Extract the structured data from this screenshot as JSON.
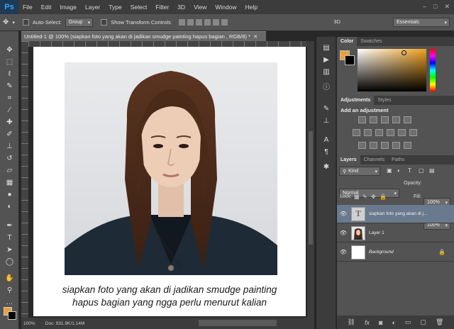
{
  "app": {
    "logo": "Ps"
  },
  "menu": [
    "File",
    "Edit",
    "Image",
    "Layer",
    "Type",
    "Select",
    "Filter",
    "3D",
    "View",
    "Window",
    "Help"
  ],
  "window_controls": [
    "–",
    "□",
    "✕"
  ],
  "options": {
    "auto_select_label": "Auto-Select:",
    "auto_select_value": "Group",
    "show_transform_label": "Show Transform Controls",
    "mode_3d_label": "3D",
    "workspace": "Essentials"
  },
  "document": {
    "tab_title": "Untitled-1 @ 100% (siapkan foto yang akan di jadikan smudge painting hapus bagian , RGB/8) *",
    "caption_line1": "siapkan foto yang akan di jadikan smudge painting",
    "caption_line2": "hapus bagian yang ngga perlu menurut kalian",
    "zoom": "100%",
    "doc_size": "Doc: 931.9K/1.14M"
  },
  "color_panel": {
    "tabs": [
      "Color",
      "Swatches"
    ],
    "foreground": "#e8a13a",
    "background": "#000000"
  },
  "adjustments_panel": {
    "tabs": [
      "Adjustments",
      "Styles"
    ],
    "title": "Add an adjustment"
  },
  "layers_panel": {
    "tabs": [
      "Layers",
      "Channels",
      "Paths"
    ],
    "kind_label": "Kind",
    "blend_mode": "Normal",
    "opacity_label": "Opacity:",
    "opacity_value": "100%",
    "lock_label": "Lock:",
    "fill_label": "Fill:",
    "fill_value": "100%",
    "layers": [
      {
        "name": "siapkan foto yang akan di j...",
        "type": "text",
        "thumb": "T"
      },
      {
        "name": "Layer 1",
        "type": "image"
      },
      {
        "name": "Background",
        "type": "background"
      }
    ],
    "bottom_icons": [
      "link-icon",
      "fx-icon",
      "mask-icon",
      "adjustment-layer-icon",
      "group-icon",
      "new-layer-icon",
      "trash-icon"
    ]
  }
}
